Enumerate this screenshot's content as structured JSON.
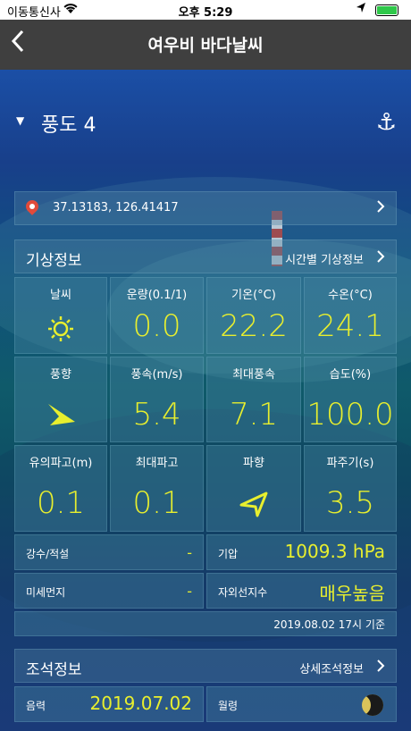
{
  "status": {
    "carrier": "이동통신사",
    "time": "오후 5:29"
  },
  "nav": {
    "title": "여우비 바다날씨"
  },
  "wind_zone": {
    "label": "풍도 4"
  },
  "location": {
    "coords": "37.13183, 126.41417"
  },
  "weather": {
    "header": "기상정보",
    "link": "시간별 기상정보",
    "cells": [
      {
        "title": "날씨",
        "icon": "sun-icon"
      },
      {
        "title": "운량(0.1/1)",
        "value": "0.0"
      },
      {
        "title": "기온(°C)",
        "value": "22.2"
      },
      {
        "title": "수온(°C)",
        "value": "24.1"
      },
      {
        "title": "풍향",
        "icon": "wind-direction-arrow-icon"
      },
      {
        "title": "풍속(m/s)",
        "value": "5.4"
      },
      {
        "title": "최대풍속",
        "value": "7.1"
      },
      {
        "title": "습도(%)",
        "value": "100.0"
      },
      {
        "title": "유의파고(m)",
        "value": "0.1"
      },
      {
        "title": "최대파고",
        "value": "0.1"
      },
      {
        "title": "파향",
        "icon": "wave-direction-arrow-icon"
      },
      {
        "title": "파주기(s)",
        "value": "3.5"
      }
    ],
    "rows": [
      {
        "label": "강수/적설",
        "value": "-"
      },
      {
        "label": "기압",
        "value": "1009.3 hPa"
      },
      {
        "label": "미세먼지",
        "value": "-"
      },
      {
        "label": "자외선지수",
        "value": "매우높음"
      }
    ],
    "timestamp": "2019.08.02 17시 기준"
  },
  "tide": {
    "header": "조석정보",
    "link": "상세조석정보",
    "lunar_label": "음력",
    "lunar_value": "2019.07.02",
    "moon_label": "월령"
  },
  "colors": {
    "accent": "#e8ef2e",
    "nav": "#3f3f3f"
  }
}
